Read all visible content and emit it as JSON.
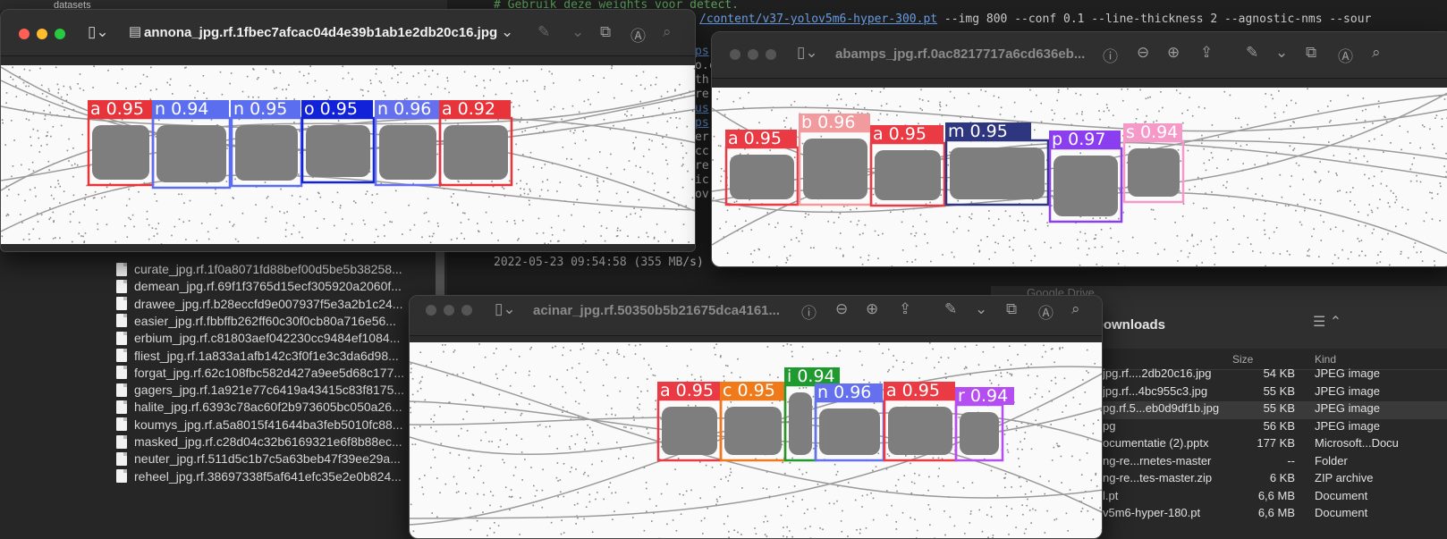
{
  "finder": {
    "top_label": "datasets",
    "files": [
      "curate_jpg.rf.1f0a8071fd88bef00d5be5b38258...",
      "demean_jpg.rf.69f1f3765d15ecf305920a2060f...",
      "drawee_jpg.rf.b28eccfd9e007937f5e3a2b1c24...",
      "easier_jpg.rf.fbbffb262ff60c30f0cb80a716e56...",
      "erbium_jpg.rf.c81803aef042230cc9484ef1084...",
      "fliest_jpg.rf.1a833a1afb142c3f0f1e3c3da6d98...",
      "forgat_jpg.rf.62c108fbc582d427a9ee5d68c177...",
      "gagers_jpg.rf.1a921e77c6419a43415c83f8175...",
      "halite_jpg.rf.6393c78ac60f2b973605bc050a26...",
      "koumys_jpg.rf.a5a8015f41644ba3feb5010fc88...",
      "masked_jpg.rf.c28d04c32b6169321e6f8b88ec...",
      "neuter_jpg.rf.511d5c1b7c5a63beb47f39ee29a...",
      "reheel_jpg.rf.38697338f5af641efc35e2e0b824..."
    ]
  },
  "terminal": {
    "comment": "# Gebruik deze weights voor detect.",
    "command_path": "/content/v37-yolov5m6-hyper-300.pt",
    "command_args": " --img 800 --conf 0.1 --line-thickness 2 --agnostic-nms --sour",
    "timestamp": "2022-05-23 09:54:58 (355 MB/s)",
    "left_fragments": [
      "ps",
      "o.c",
      "th",
      "re",
      "us",
      "ps",
      "er",
      "cc",
      "re",
      "ic",
      "ov"
    ]
  },
  "downloads": {
    "title": "Downloads",
    "location_crumb": "Google Drive",
    "col_size": "Size",
    "col_kind": "Kind",
    "rows": [
      {
        "name": "jpg.rf....2db20c16.jpg",
        "size": "54 KB",
        "kind": "JPEG image"
      },
      {
        "name": "jpg.rf...4bc955c3.jpg",
        "size": "55 KB",
        "kind": "JPEG image"
      },
      {
        "name": "pg.rf.5...eb0d9df1b.jpg",
        "size": "55 KB",
        "kind": "JPEG image"
      },
      {
        "name": "pg",
        "size": "56 KB",
        "kind": "JPEG image"
      },
      {
        "name": "ocumentatie (2).pptx",
        "size": "177 KB",
        "kind": "Microsoft...Docu"
      },
      {
        "name": "ng-re...rnetes-master",
        "size": "--",
        "kind": "Folder"
      },
      {
        "name": "ng-re...tes-master.zip",
        "size": "6 KB",
        "kind": "ZIP archive"
      },
      {
        "name": "l.pt",
        "size": "6,6 MB",
        "kind": "Document"
      },
      {
        "name": "v5m6-hyper-180.pt",
        "size": "6,6 MB",
        "kind": "Document"
      }
    ]
  },
  "windows": [
    {
      "title": "annona_jpg.rf.1fbec7afcac04d4e39b1ab1e2db20c16.jpg",
      "active": true,
      "detections": [
        {
          "label": "a 0.95",
          "color": "#e8333b"
        },
        {
          "label": "n 0.94",
          "color": "#5b6ef0"
        },
        {
          "label": "n 0.95",
          "color": "#5b6ef0"
        },
        {
          "label": "o 0.95",
          "color": "#1222d8"
        },
        {
          "label": "n 0.96",
          "color": "#6470ee"
        },
        {
          "label": "a 0.92",
          "color": "#e8333b"
        }
      ]
    },
    {
      "title": "abamps_jpg.rf.0ac8217717a6cd636eb...",
      "active": false,
      "detections": [
        {
          "label": "a 0.95",
          "color": "#ea3a44"
        },
        {
          "label": "b 0.96",
          "color": "#f29b9e"
        },
        {
          "label": "a 0.95",
          "color": "#ea3a44"
        },
        {
          "label": "m 0.95",
          "color": "#2e3680"
        },
        {
          "label": "p 0.97",
          "color": "#8a3ef0"
        },
        {
          "label": "s 0.94",
          "color": "#f59ac8"
        }
      ]
    },
    {
      "title": "acinar_jpg.rf.50350b5b21675dca4161...",
      "active": false,
      "detections": [
        {
          "label": "a 0.95",
          "color": "#ea3a44"
        },
        {
          "label": "c 0.95",
          "color": "#f07a1a"
        },
        {
          "label": "i 0.94",
          "color": "#1e9a2e"
        },
        {
          "label": "n 0.96",
          "color": "#6470ee"
        },
        {
          "label": "a 0.95",
          "color": "#ea3a44"
        },
        {
          "label": "r 0.94",
          "color": "#b44ef0"
        }
      ]
    }
  ],
  "icons": [
    "sidebar-icon",
    "document-icon",
    "chevron-down-icon",
    "info-icon",
    "zoom-out-icon",
    "zoom-in-icon",
    "share-icon",
    "markup-icon",
    "rotate-icon",
    "annotate-icon",
    "search-icon"
  ]
}
